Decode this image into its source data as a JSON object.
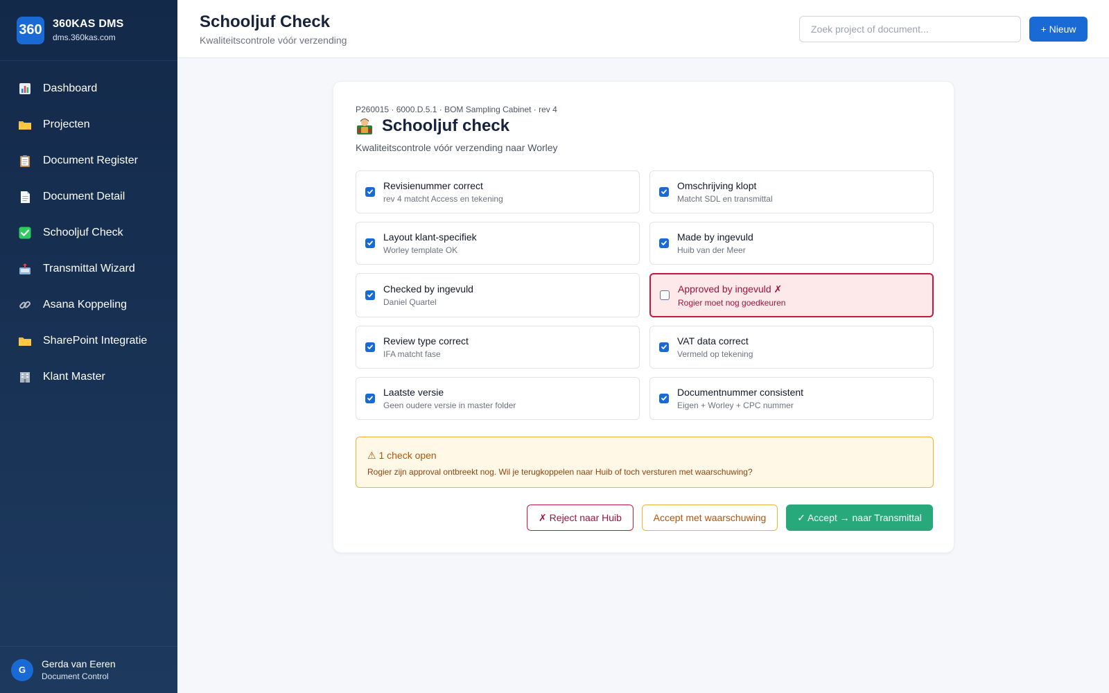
{
  "brand": {
    "logo": "360",
    "title": "360KAS DMS",
    "subtitle": "dms.360kas.com"
  },
  "nav": [
    {
      "label": "Dashboard",
      "icon": "bar-chart-icon"
    },
    {
      "label": "Projecten",
      "icon": "folder-icon"
    },
    {
      "label": "Document Register",
      "icon": "clipboard-icon"
    },
    {
      "label": "Document Detail",
      "icon": "document-icon"
    },
    {
      "label": "Schooljuf Check",
      "icon": "check-box-icon"
    },
    {
      "label": "Transmittal Wizard",
      "icon": "outbox-icon"
    },
    {
      "label": "Asana Koppeling",
      "icon": "link-icon"
    },
    {
      "label": "SharePoint Integratie",
      "icon": "folder-icon"
    },
    {
      "label": "Klant Master",
      "icon": "office-building-icon"
    }
  ],
  "user": {
    "initial": "G",
    "name": "Gerda van Eeren",
    "role": "Document Control"
  },
  "header": {
    "title": "Schooljuf Check",
    "subtitle": "Kwaliteitscontrole vóór verzending",
    "search_placeholder": "Zoek project of document...",
    "new_button": "+ Nieuw"
  },
  "card": {
    "meta": "P260015 · 6000.D.5.1 · BOM Sampling Cabinet · rev 4",
    "title": "Schooljuf check",
    "title_icon": "teacher-icon",
    "subtitle": "Kwaliteitscontrole vóór verzending naar Worley",
    "checks": [
      {
        "label": "Revisienummer correct",
        "hint": "rev 4 matcht Access en tekening",
        "checked": true
      },
      {
        "label": "Omschrijving klopt",
        "hint": "Matcht SDL en transmittal",
        "checked": true
      },
      {
        "label": "Layout klant-specifiek",
        "hint": "Worley template OK",
        "checked": true
      },
      {
        "label": "Made by ingevuld",
        "hint": "Huib van der Meer",
        "checked": true
      },
      {
        "label": "Checked by ingevuld",
        "hint": "Daniel Quartel",
        "checked": true
      },
      {
        "label": "Approved by ingevuld ✗",
        "hint": "Rogier moet nog goedkeuren",
        "checked": false
      },
      {
        "label": "Review type correct",
        "hint": "IFA matcht fase",
        "checked": true
      },
      {
        "label": "VAT data correct",
        "hint": "Vermeld op tekening",
        "checked": true
      },
      {
        "label": "Laatste versie",
        "hint": "Geen oudere versie in master folder",
        "checked": true
      },
      {
        "label": "Documentnummer consistent",
        "hint": "Eigen + Worley + CPC nummer",
        "checked": true
      }
    ],
    "warning": {
      "title": "⚠ 1 check open",
      "text": "Rogier zijn approval ontbreekt nog. Wil je terugkoppelen naar Huib of toch versturen met waarschuwing?"
    },
    "actions": {
      "reject": "✗ Reject naar Huib",
      "warn": "Accept met waarschuwing",
      "accept": "✓ Accept → naar Transmittal"
    }
  },
  "colors": {
    "accent": "#1a6ad6",
    "sidebar": "#13294a",
    "danger": "#c2193d",
    "warning": "#f0b33a",
    "success": "#27a97b"
  }
}
